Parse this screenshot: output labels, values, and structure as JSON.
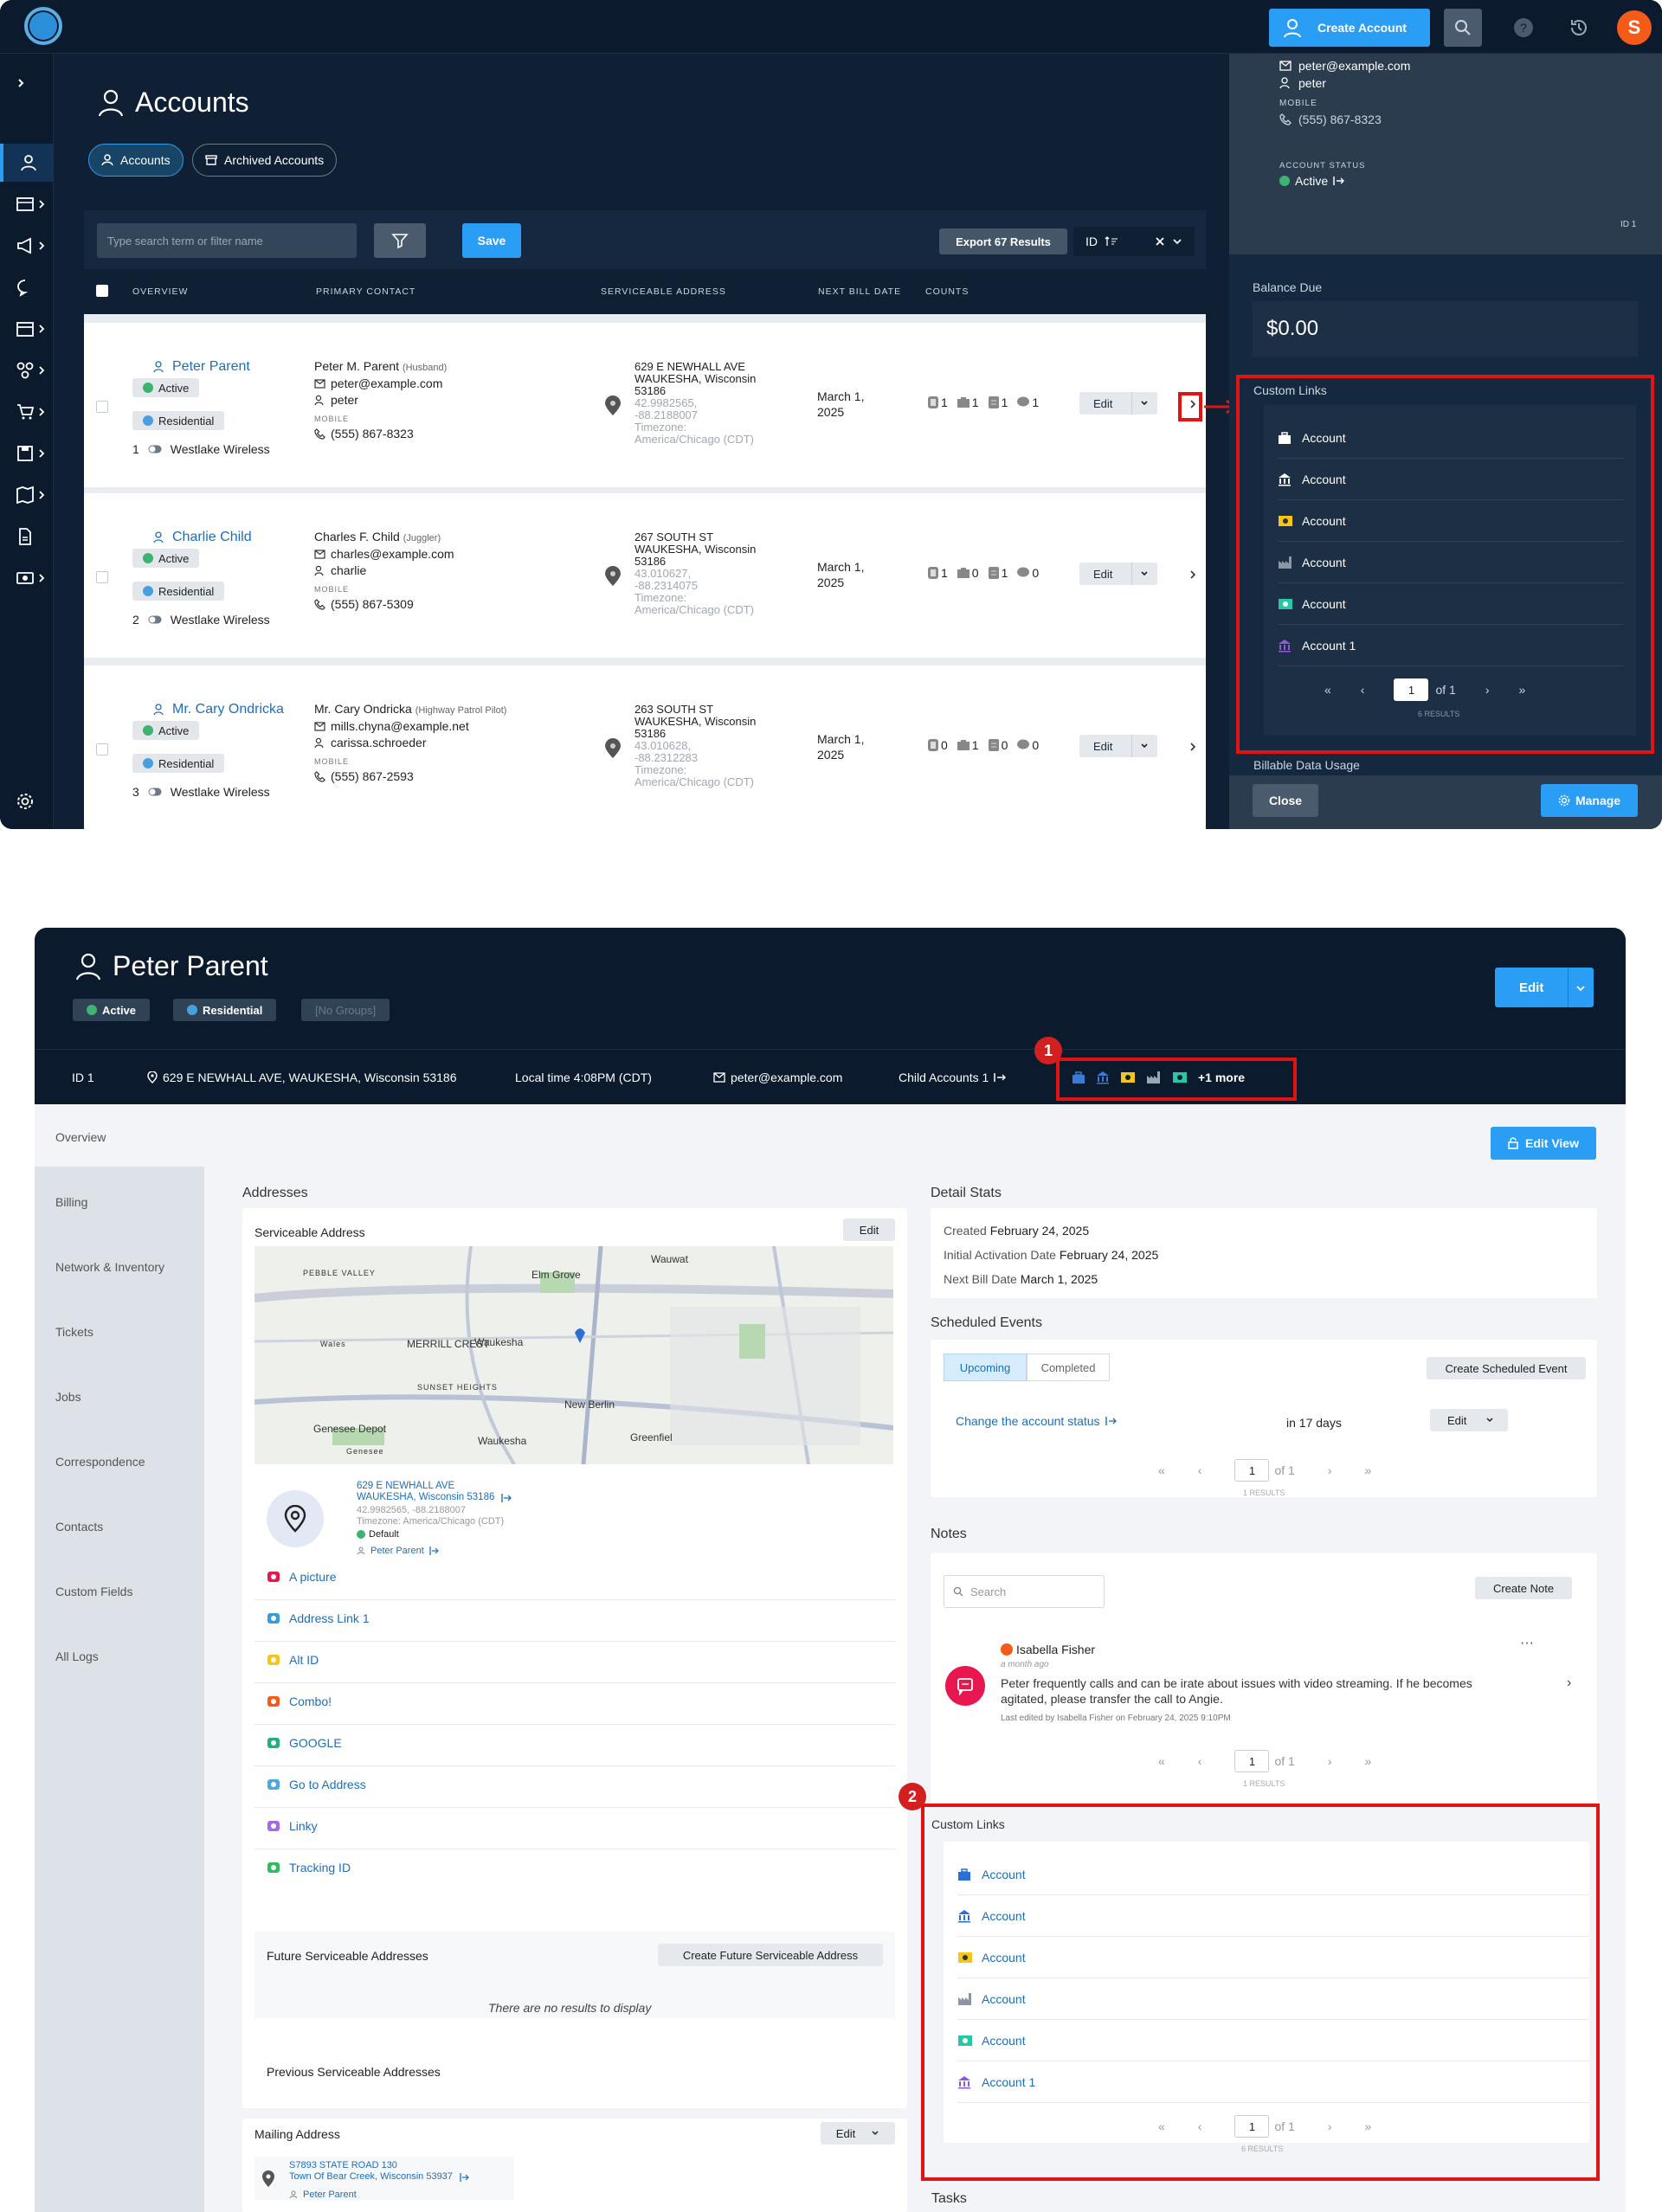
{
  "screenA": {
    "topbar": {
      "create_account": "Create Account",
      "avatar_letter": "S"
    },
    "page_title": "Accounts",
    "tabs": [
      {
        "label": "Accounts"
      },
      {
        "label": "Archived Accounts"
      }
    ],
    "toolbar": {
      "search_placeholder": "Type search term or filter name",
      "save": "Save",
      "export": "Export 67 Results",
      "sort_label": "ID"
    },
    "columns": [
      "OVERVIEW",
      "PRIMARY CONTACT",
      "SERVICEABLE ADDRESS",
      "NEXT BILL DATE",
      "COUNTS"
    ],
    "rows": [
      {
        "name": "Peter Parent",
        "status": "Active",
        "type": "Residential",
        "index": "1",
        "provider": "Westlake Wireless",
        "contact_name": "Peter M. Parent",
        "contact_role": "(Husband)",
        "email": "peter@example.com",
        "username": "peter",
        "mobile_label": "MOBILE",
        "phone": "(555) 867-8323",
        "addr1": "629 E NEWHALL AVE",
        "addr2": "WAUKESHA, Wisconsin",
        "addr3": "53186",
        "coords1": "42.9982565,",
        "coords2": "-88.2188007",
        "tz1": "Timezone:",
        "tz2": "America/Chicago (CDT)",
        "bill1": "March 1,",
        "bill2": "2025",
        "counts": [
          "1",
          "1",
          "1",
          "1"
        ],
        "edit": "Edit"
      },
      {
        "name": "Charlie Child",
        "status": "Active",
        "type": "Residential",
        "index": "2",
        "provider": "Westlake Wireless",
        "contact_name": "Charles F. Child",
        "contact_role": "(Juggler)",
        "email": "charles@example.com",
        "username": "charlie",
        "mobile_label": "MOBILE",
        "phone": "(555) 867-5309",
        "addr1": "267 SOUTH ST",
        "addr2": "WAUKESHA, Wisconsin",
        "addr3": "53186",
        "coords1": "43.010627,",
        "coords2": "-88.2314075",
        "tz1": "Timezone:",
        "tz2": "America/Chicago (CDT)",
        "bill1": "March 1,",
        "bill2": "2025",
        "counts": [
          "1",
          "0",
          "1",
          "0"
        ],
        "edit": "Edit"
      },
      {
        "name": "Mr. Cary Ondricka",
        "status": "Active",
        "type": "Residential",
        "index": "3",
        "provider": "Westlake Wireless",
        "contact_name": "Mr. Cary Ondricka",
        "contact_role": "(Highway Patrol Pilot)",
        "email": "mills.chyna@example.net",
        "username": "carissa.schroeder",
        "mobile_label": "MOBILE",
        "phone": "(555) 867-2593",
        "addr1": "263 SOUTH ST",
        "addr2": "WAUKESHA, Wisconsin",
        "addr3": "53186",
        "coords1": "43.010628,",
        "coords2": "-88.2312283",
        "tz1": "Timezone:",
        "tz2": "America/Chicago (CDT)",
        "bill1": "March 1,",
        "bill2": "2025",
        "counts": [
          "0",
          "1",
          "0",
          "0"
        ],
        "edit": "Edit"
      }
    ],
    "side": {
      "email": "peter@example.com",
      "username": "peter",
      "mobile_label": "MOBILE",
      "phone": "(555) 867-8323",
      "status_label": "ACCOUNT STATUS",
      "status": "Active",
      "id_label": "ID 1",
      "balance_label": "Balance Due",
      "balance": "$0.00",
      "custom_links_label": "Custom Links",
      "links": [
        "Account",
        "Account",
        "Account",
        "Account",
        "Account",
        "Account 1"
      ],
      "page": "1",
      "of": "of 1",
      "results": "6 RESULTS",
      "billable_label": "Billable Data Usage",
      "close": "Close",
      "manage": "Manage"
    }
  },
  "screenB": {
    "title": "Peter Parent",
    "tags": [
      "Active",
      "Residential",
      "[No Groups]"
    ],
    "edit": "Edit",
    "info": {
      "id": "ID  1",
      "address": "629 E NEWHALL AVE, WAUKESHA, Wisconsin 53186",
      "local_time": "Local time 4:08PM (CDT)",
      "email": "peter@example.com",
      "child": "Child Accounts  1",
      "more": "+1 more"
    },
    "badges": [
      "1",
      "2"
    ],
    "nav": [
      "Overview",
      "Billing",
      "Network & Inventory",
      "Tickets",
      "Jobs",
      "Correspondence",
      "Contacts",
      "Custom Fields",
      "All Logs"
    ],
    "edit_view": "Edit View",
    "addresses": {
      "title": "Addresses",
      "serviceable": "Serviceable Address",
      "edit": "Edit",
      "map_labels": [
        "PEBBLE VALLEY",
        "Elm Grove",
        "Wauwat",
        "Wales",
        "MERRILL CREST",
        "Waukesha",
        "SUNSET HEIGHTS",
        "New Berlin",
        "Genesee Depot",
        "Genesee",
        "Waukesha",
        "Greenfiel"
      ],
      "addr1": "629 E NEWHALL AVE",
      "addr2": "WAUKESHA, Wisconsin 53186",
      "coords": "42.9982565, -88.2188007",
      "tz": "Timezone: America/Chicago (CDT)",
      "default": "Default",
      "owner": "Peter Parent",
      "links": [
        "A picture",
        "Address Link 1",
        "Alt ID",
        "Combo!",
        "GOOGLE",
        "Go to Address",
        "Linky",
        "Tracking ID"
      ],
      "future": "Future Serviceable Addresses",
      "create_future": "Create Future Serviceable Address",
      "no_results": "There are no results to display",
      "previous": "Previous Serviceable Addresses",
      "mailing": "Mailing Address",
      "mail1": "S7893 STATE ROAD 130",
      "mail2": "Town Of Bear Creek, Wisconsin 53937",
      "mail_owner": "Peter Parent"
    },
    "detail": {
      "title": "Detail Stats",
      "created_l": "Created",
      "created": "February 24, 2025",
      "init_l": "Initial Activation Date",
      "init": "February 24, 2025",
      "next_l": "Next Bill Date",
      "next": "March 1, 2025"
    },
    "events": {
      "title": "Scheduled Events",
      "tab1": "Upcoming",
      "tab2": "Completed",
      "create": "Create Scheduled Event",
      "event": "Change the account status",
      "when": "in 17 days",
      "edit": "Edit",
      "page": "1",
      "of": "of 1",
      "results": "1 RESULTS"
    },
    "notes": {
      "title": "Notes",
      "search": "Search",
      "create": "Create Note",
      "author": "Isabella Fisher",
      "time": "a month ago",
      "text1": "Peter frequently calls and can be irate about issues with video streaming. If he becomes",
      "text2": "agitated, please transfer the call to Angie.",
      "edited": "Last edited by Isabella Fisher on February 24, 2025 9:10PM",
      "page": "1",
      "of": "of 1",
      "results": "1 RESULTS"
    },
    "custom_links": {
      "title": "Custom Links",
      "links": [
        "Account",
        "Account",
        "Account",
        "Account",
        "Account",
        "Account 1"
      ],
      "page": "1",
      "of": "of 1",
      "results": "6 RESULTS"
    },
    "tasks": "Tasks"
  },
  "colors": {
    "accent": "#2a9df4",
    "dark": "#0b1a2c",
    "annotation": "#e11414",
    "active": "#3cb371",
    "residential": "#4a9fe0"
  }
}
